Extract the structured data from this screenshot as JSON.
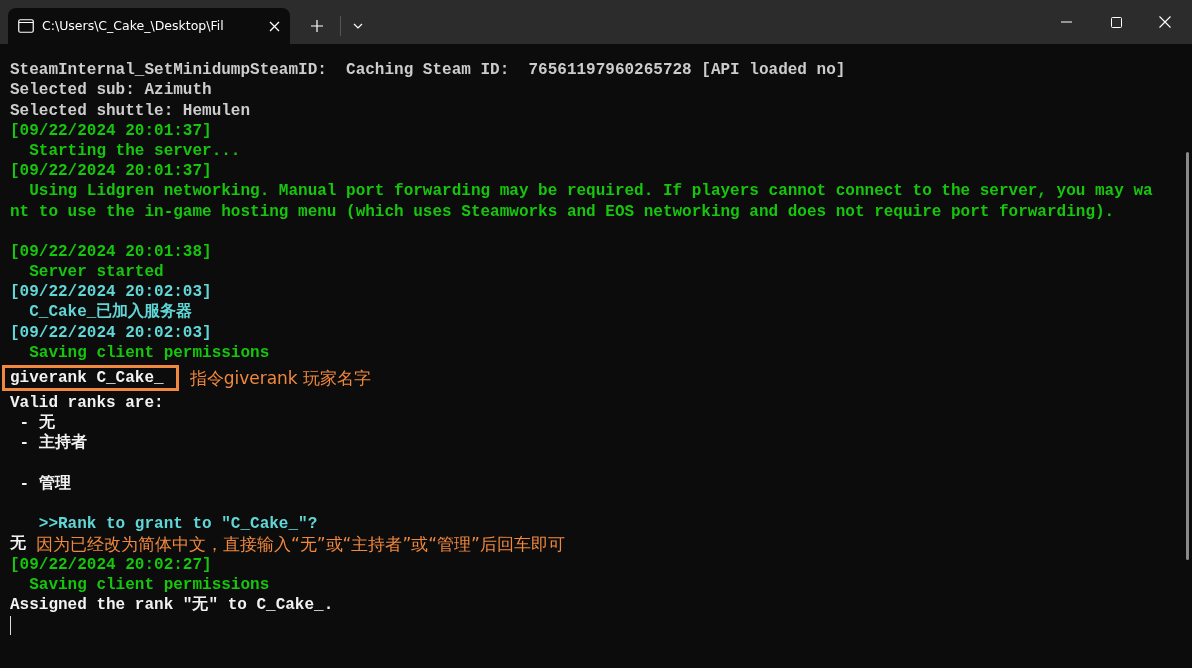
{
  "window": {
    "tab_title": "C:\\Users\\C_Cake_\\Desktop\\Fil"
  },
  "lines": [
    {
      "kind": "text",
      "text": "SteamInternal_SetMinidumpSteamID:  Caching Steam ID:  76561197960265728 [API loaded no]",
      "color": "#cccccc"
    },
    {
      "kind": "text",
      "text": "Selected sub: Azimuth",
      "color": "#cccccc"
    },
    {
      "kind": "text",
      "text": "Selected shuttle: Hemulen",
      "color": "#cccccc"
    },
    {
      "kind": "text",
      "text": "[09/22/2024 20:01:37]",
      "color": "#16c60c"
    },
    {
      "kind": "text",
      "text": "  Starting the server...",
      "color": "#16c60c"
    },
    {
      "kind": "text",
      "text": "[09/22/2024 20:01:37]",
      "color": "#16c60c"
    },
    {
      "kind": "text",
      "text": "  Using Lidgren networking. Manual port forwarding may be required. If players cannot connect to the server, you may wa",
      "color": "#16c60c"
    },
    {
      "kind": "text",
      "text": "nt to use the in-game hosting menu (which uses Steamworks and EOS networking and does not require port forwarding).",
      "color": "#16c60c"
    },
    {
      "kind": "blank"
    },
    {
      "kind": "text",
      "text": "[09/22/2024 20:01:38]",
      "color": "#16c60c"
    },
    {
      "kind": "text",
      "text": "  Server started",
      "color": "#16c60c"
    },
    {
      "kind": "text",
      "text": "[09/22/2024 20:02:03]",
      "color": "#61d6d6"
    },
    {
      "kind": "text",
      "text": "  C_Cake_已加入服务器",
      "color": "#61d6d6"
    },
    {
      "kind": "text",
      "text": "[09/22/2024 20:02:03]",
      "color": "#61d6d6"
    },
    {
      "kind": "text",
      "text": "  Saving client permissions",
      "color": "#16c60c"
    },
    {
      "kind": "boxed",
      "text": "giverank C_Cake_",
      "note": "指令giverank 玩家名字"
    },
    {
      "kind": "text",
      "text": "Valid ranks are:",
      "color": "#f2f2f2"
    },
    {
      "kind": "text",
      "text": " - 无",
      "color": "#f2f2f2"
    },
    {
      "kind": "text",
      "text": " - 主持者",
      "color": "#f2f2f2"
    },
    {
      "kind": "blank"
    },
    {
      "kind": "text",
      "text": " - 管理",
      "color": "#f2f2f2"
    },
    {
      "kind": "blank"
    },
    {
      "kind": "text",
      "text": "   >>Rank to grant to \"C_Cake_\"?",
      "color": "#61d6d6"
    },
    {
      "kind": "noted",
      "text": "无",
      "color": "#f2f2f2",
      "note": "因为已经改为简体中文，直接输入“无”或“主持者”或“管理”后回车即可"
    },
    {
      "kind": "text",
      "text": "[09/22/2024 20:02:27]",
      "color": "#16c60c"
    },
    {
      "kind": "text",
      "text": "  Saving client permissions",
      "color": "#16c60c"
    },
    {
      "kind": "text",
      "text": "Assigned the rank \"无\" to C_Cake_.",
      "color": "#f2f2f2"
    },
    {
      "kind": "cursor"
    }
  ]
}
